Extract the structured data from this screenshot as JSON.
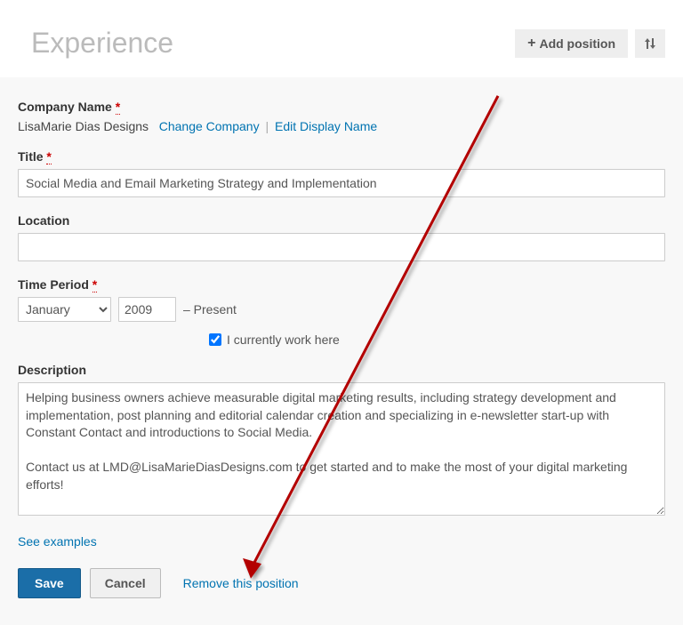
{
  "header": {
    "title": "Experience",
    "add_position_label": "Add position"
  },
  "form": {
    "company": {
      "label": "Company Name",
      "value": "LisaMarie Dias Designs",
      "change_company_link": "Change Company",
      "edit_display_link": "Edit Display Name"
    },
    "title": {
      "label": "Title",
      "value": "Social Media and Email Marketing Strategy and Implementation"
    },
    "location": {
      "label": "Location",
      "value": ""
    },
    "time_period": {
      "label": "Time Period",
      "month": "January",
      "year": "2009",
      "present_text": "– Present",
      "currently_work_label": "I currently work here",
      "currently_work_checked": true
    },
    "description": {
      "label": "Description",
      "value": "Helping business owners achieve measurable digital marketing results, including strategy development and implementation, post planning and editorial calendar creation and specializing in e-newsletter start-up with Constant Contact and introductions to Social Media.\n\nContact us at LMD@LisaMarieDiasDesigns.com to get started and to make the most of your digital marketing efforts!"
    },
    "see_examples_link": "See examples",
    "save_label": "Save",
    "cancel_label": "Cancel",
    "remove_link": "Remove this position"
  },
  "required_marker": "*"
}
